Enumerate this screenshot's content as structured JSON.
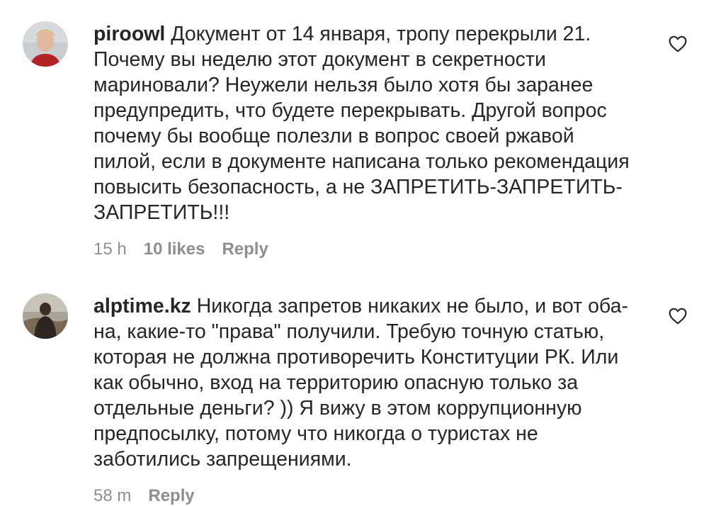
{
  "comments": [
    {
      "username": "piroowl",
      "text": " Документ от 14 января, тропу перекрыли 21.\nПочему вы неделю этот документ в секретности\nмариновали? Неужели нельзя было хотя бы заранее\nпредупредить, что будете перекрывать. Другой вопрос\nпочему бы вообще полезли в вопрос своей ржавой\nпилой, если в документе написана только рекомендация\nповысить безопасность, а не ЗАПРЕТИТЬ-ЗАПРЕТИТЬ-\nЗАПРЕТИТЬ!!!",
      "time": "15 h",
      "likes": "10 likes",
      "reply": "Reply",
      "icon": "heart-outline-icon"
    },
    {
      "username": "alptime.kz",
      "text": " Никогда запретов никаких не было, и вот оба-\nна, какие-то \"права\" получили. Требую точную статью,\nкоторая не должна противоречить Конституции РК. Или\nкак обычно, вход на территорию опасную только за\nотдельные деньги? )) Я вижу в этом коррупционную\nпредпосылку, потому что никогда о туристах не\nзаботились запрещениями.",
      "time": "58 m",
      "reply": "Reply",
      "icon": "heart-outline-icon"
    }
  ],
  "colors": {
    "text": "#262626",
    "secondary": "#8e8e8e",
    "background": "#ffffff"
  }
}
